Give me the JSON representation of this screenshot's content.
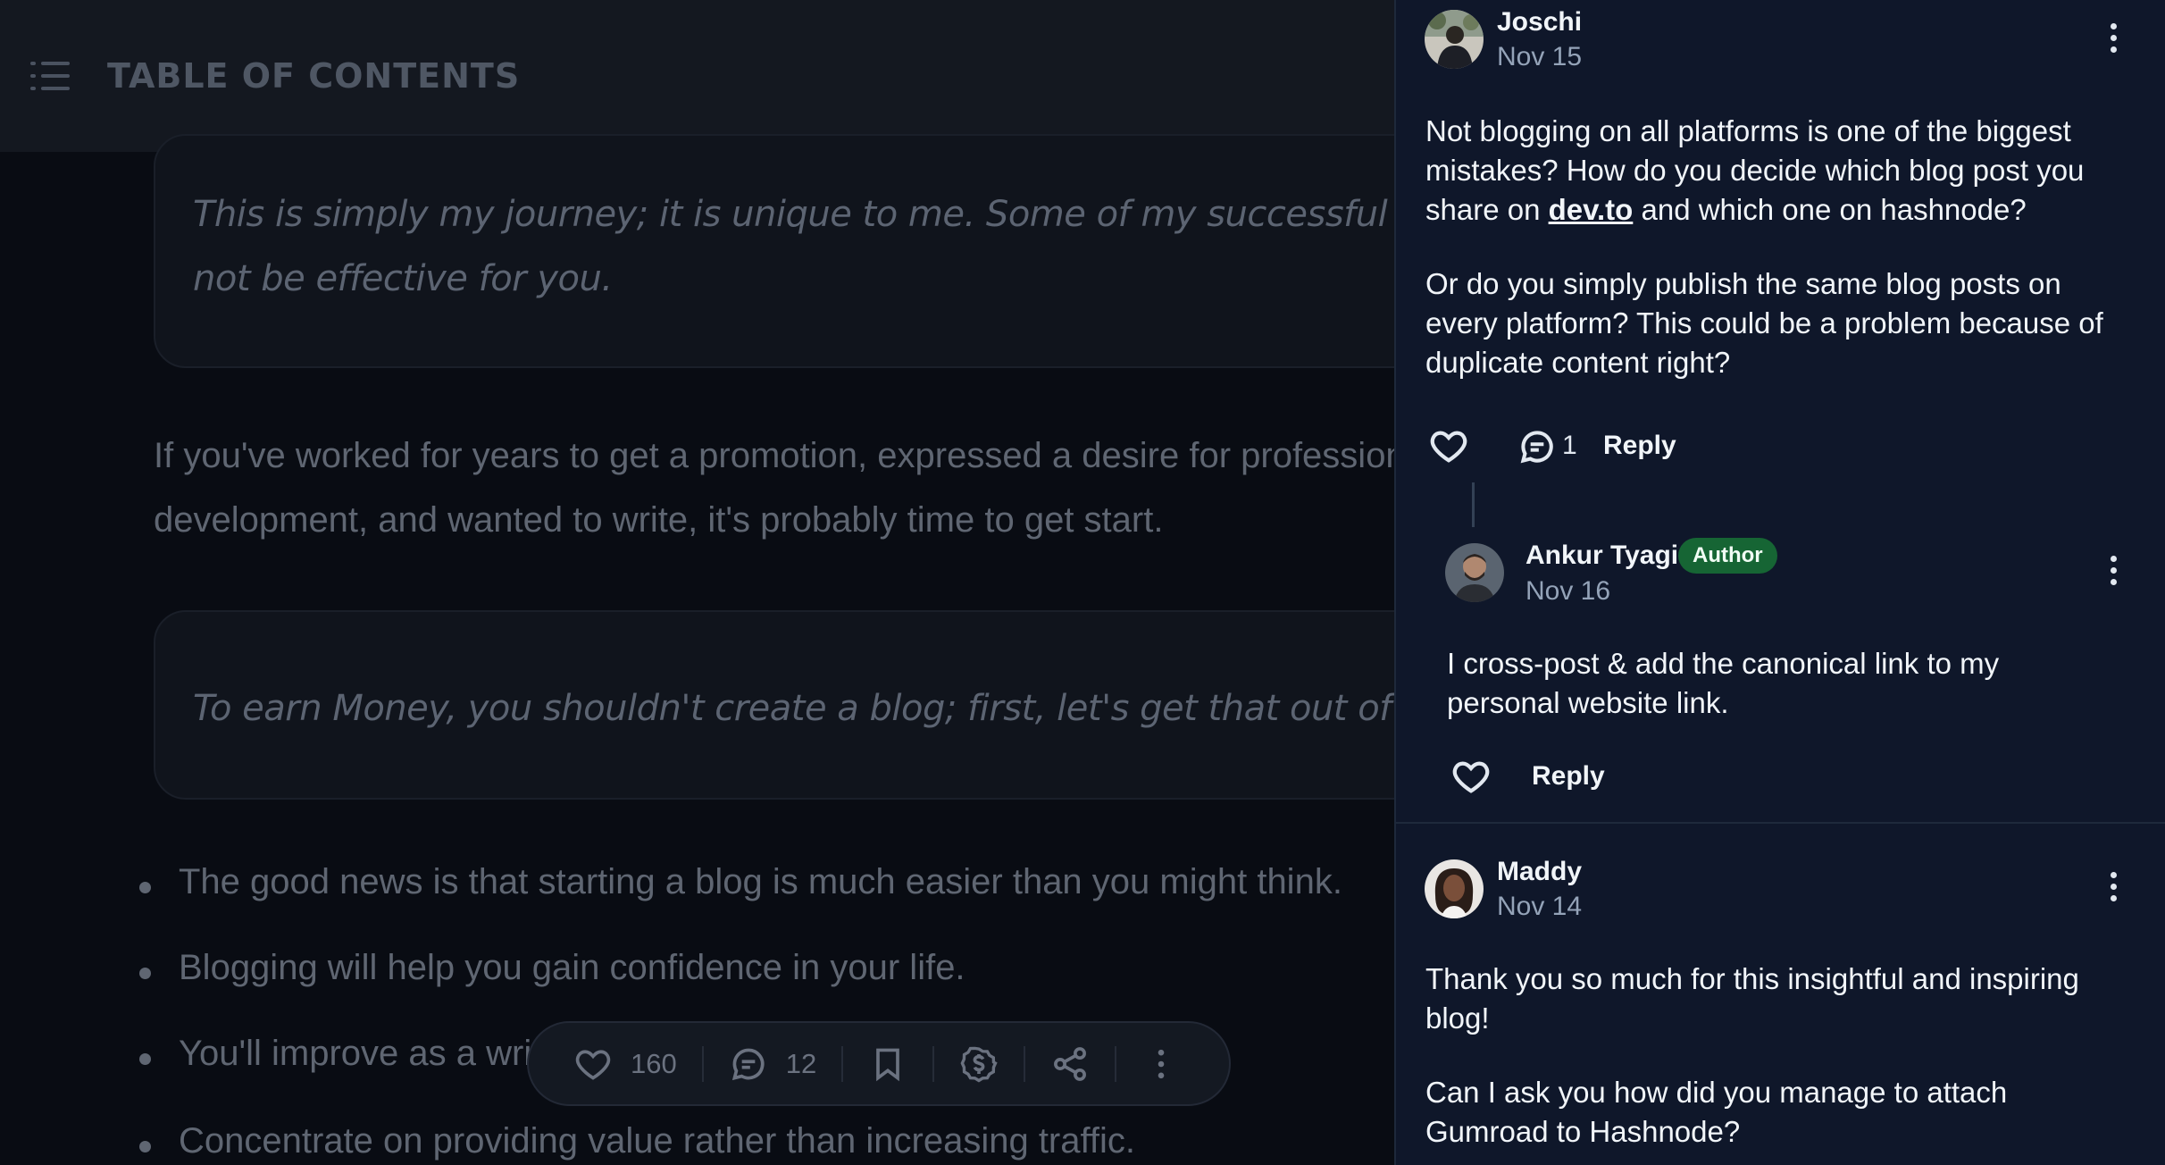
{
  "toc": {
    "title": "TABLE OF CONTENTS",
    "icon": "list-icon"
  },
  "article": {
    "quote1": {
      "line1": "This is simply my journey; it is unique to me. Some of my successful tactics may",
      "line2": "not be effective for you."
    },
    "para1": {
      "line1": "If you've worked for years to get a promotion, expressed a desire for professional",
      "line2": "development, and wanted to write, it's probably time to get start."
    },
    "quote2": {
      "line1": "To earn Money, you shouldn't create a blog; first, let's get that out of the way."
    },
    "bullets": [
      "The good news is that starting a blog is much easier than you might think.",
      "Blogging will help you gain confidence in your life.",
      "You'll improve as a writer.",
      "Concentrate on providing value rather than increasing traffic."
    ]
  },
  "action_bar": {
    "likes": "160",
    "comments": "12",
    "icons": [
      "heart-icon",
      "comment-icon",
      "bookmark-icon",
      "sponsor-icon",
      "share-icon",
      "more-icon"
    ]
  },
  "comments": [
    {
      "name": "Joschi",
      "date": "Nov 15",
      "body": {
        "l1": "Not blogging on all platforms is one of the biggest",
        "l2": "mistakes? How do you decide which blog post you",
        "l3_pre": "share on ",
        "l3_link": "dev.to",
        "l3_post": " and which one on hashnode?",
        "l4": "Or do you simply publish the same blog posts on",
        "l5": "every platform? This could be a problem because of",
        "l6": "duplicate content right?"
      },
      "reply_count": "1",
      "reply_label": "Reply",
      "replies": [
        {
          "name": "Ankur Tyagi",
          "badge": "Author",
          "date": "Nov 16",
          "body": {
            "l1": "I cross-post & add the canonical link to my",
            "l2": "personal website link."
          },
          "reply_label": "Reply"
        }
      ]
    },
    {
      "name": "Maddy",
      "date": "Nov 14",
      "body": {
        "l1": "Thank you so much for this insightful and inspiring",
        "l2": "blog!",
        "l3": "Can I ask you how did you manage to attach",
        "l4": "Gumroad to Hashnode?"
      }
    }
  ]
}
